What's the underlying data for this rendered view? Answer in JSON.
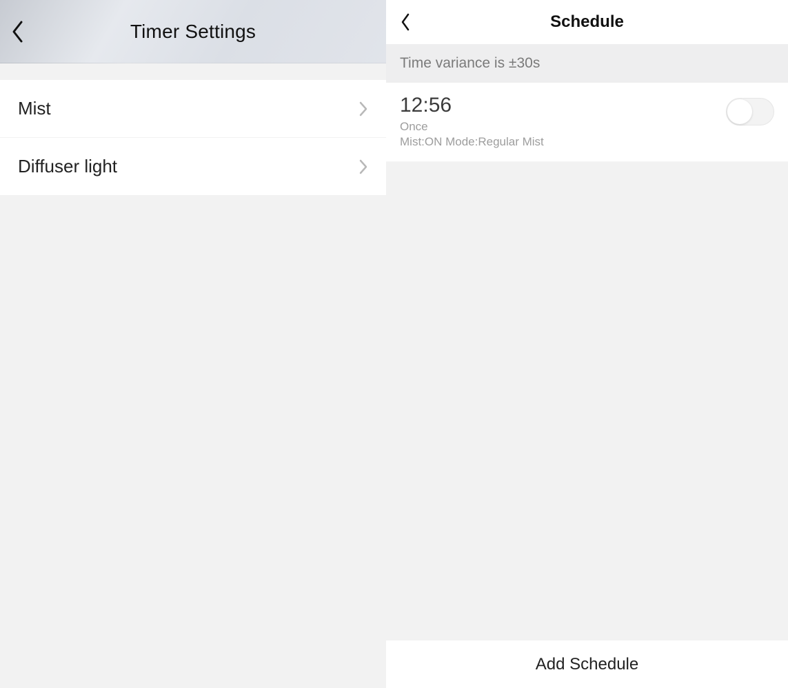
{
  "left": {
    "title": "Timer Settings",
    "items": [
      {
        "label": "Mist"
      },
      {
        "label": "Diffuser light"
      }
    ]
  },
  "right": {
    "title": "Schedule",
    "variance_text": "Time variance is  ±30s",
    "schedules": [
      {
        "time": "12:56",
        "repeat": "Once",
        "detail": "Mist:ON Mode:Regular Mist",
        "enabled": false
      }
    ],
    "add_label": "Add Schedule"
  }
}
